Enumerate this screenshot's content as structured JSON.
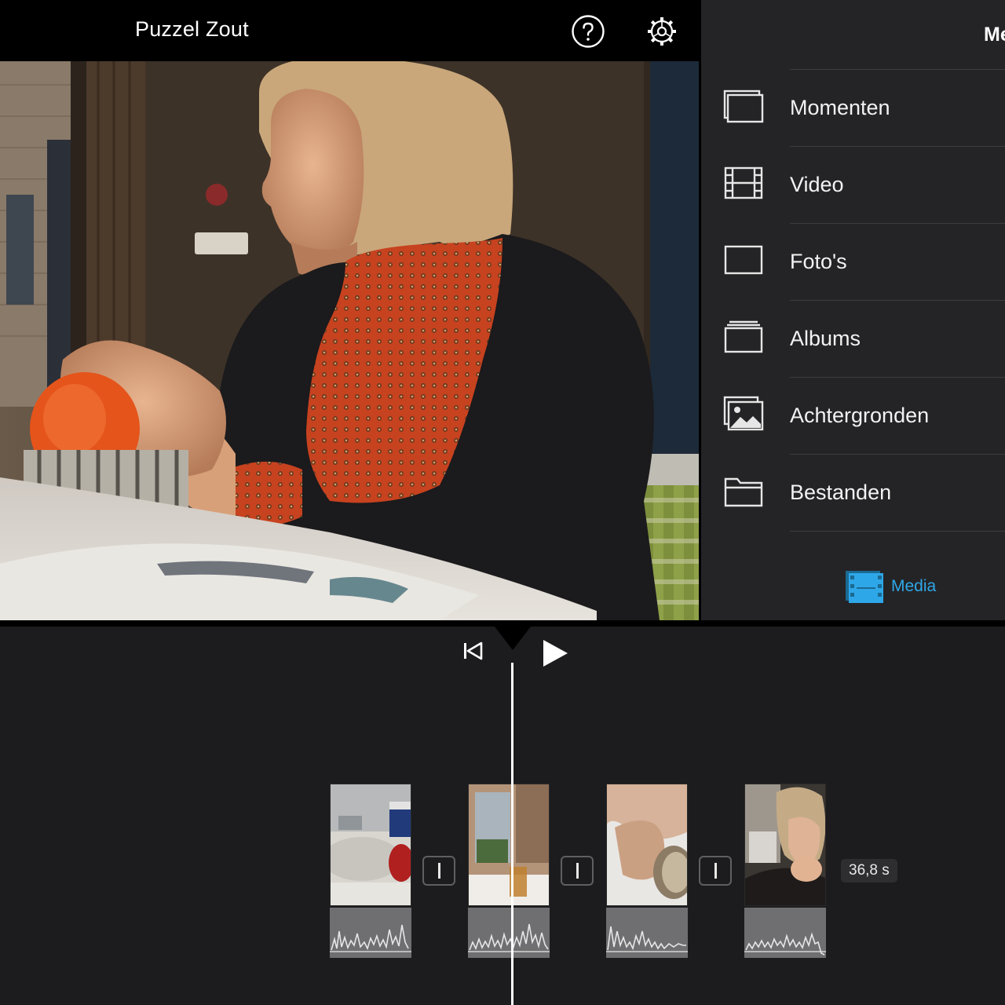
{
  "header": {
    "project_title": "Puzzel Zout",
    "help_icon": "question-circle-icon",
    "settings_icon": "gear-icon"
  },
  "panel": {
    "title": "Media",
    "items": [
      {
        "label": "Momenten",
        "icon": "stack-icon"
      },
      {
        "label": "Video",
        "icon": "film-icon"
      },
      {
        "label": "Foto's",
        "icon": "rectangle-icon"
      },
      {
        "label": "Albums",
        "icon": "album-icon"
      },
      {
        "label": "Achtergronden",
        "icon": "image-icon"
      },
      {
        "label": "Bestanden",
        "icon": "folder-icon"
      }
    ],
    "tab": {
      "label": "Media",
      "icon": "media-film-icon",
      "color": "#2ea7e8"
    }
  },
  "timeline": {
    "skip_icon": "skip-to-start-icon",
    "play_icon": "play-icon",
    "duration": "36,8 s",
    "clips": [
      {
        "name": "clip-1"
      },
      {
        "name": "clip-2"
      },
      {
        "name": "clip-3"
      },
      {
        "name": "clip-4"
      }
    ]
  },
  "colors": {
    "accent": "#2ea7e8",
    "panel_bg": "#242426",
    "timeline_bg": "#1c1c1e"
  }
}
